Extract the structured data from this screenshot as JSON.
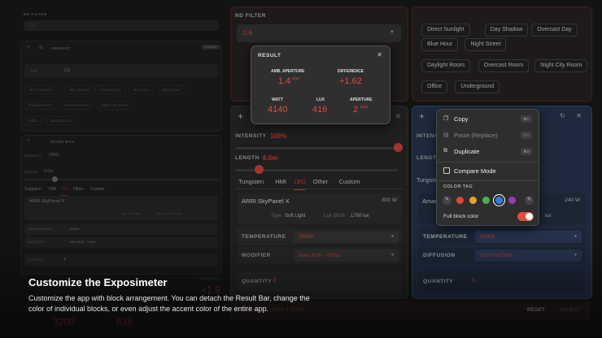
{
  "left_panel": {
    "nd_filter_label": "ND FILTER",
    "nd_filter_value": "0.6",
    "ambient_title": "AMBIENT",
    "ambient_badge": "AMBIENT",
    "lux_label": "Lux",
    "lux_value": "125",
    "chips_row1": [
      "Direct Sunlight",
      "Sky Shadow",
      "Overcast Day",
      "Blue Hour",
      "Night Street"
    ],
    "chips_row2": [
      "Daylight Room",
      "Overcast Room",
      "Night City Room"
    ],
    "chips_row3": [
      "Office",
      "Underground"
    ],
    "moon_box_title": "MOON BOX",
    "intensity_label": "INTENSITY",
    "intensity_value": "100%",
    "length_label": "LENGTH",
    "length_value": "6.0m",
    "tabs": [
      "Tungsten",
      "HMI",
      "LED",
      "Other",
      "Custom"
    ],
    "fixture": "ARRI SkyPanel X",
    "type_text": "Type: Soft Light",
    "lux_text": "Lux @ 2m: 1400 lux",
    "temperature_label": "TEMPERATURE",
    "temperature_value": "5600K",
    "modifier_label": "MODIFIER",
    "modifier_value": "Bare Bulb - HiOut",
    "quantity_label": "QUANTITY",
    "quantity_value": "4",
    "bg_watt": "3200",
    "bg_lux": "638",
    "bg_diff": "+1.9",
    "bg_diff_label": "DIFFERENCE"
  },
  "nd_panel": {
    "label": "ND FILTER",
    "value": "0.6"
  },
  "ambient_chips": {
    "row1": [
      "Direct Sunlight",
      "Day Shadow",
      "Overcast Day"
    ],
    "row2": [
      "Blue Hour",
      "Night Street"
    ],
    "row3": [
      "Daylight Room",
      "Overcast Room",
      "Night City Room"
    ],
    "row4": [
      "Office",
      "Underground"
    ]
  },
  "result": {
    "title": "RESULT",
    "amb_aperture_label": "AMB. APERTURE",
    "amb_aperture_value": "1.4",
    "amb_aperture_fraction": "4/10",
    "difference_label": "DIFFERENCE",
    "difference_value": "+1.62",
    "watt_label": "WATT",
    "watt_value": "4140",
    "lux_label": "LUX",
    "lux_value": "416",
    "aperture_label": "APERTURE",
    "aperture_value": "2",
    "aperture_fraction": "6/10"
  },
  "light_block": {
    "intensity_label": "INTENSITY",
    "intensity_value": "100%",
    "intensity_level": 1.0,
    "length_label": "LENGTH",
    "length_value": "6.0m",
    "tabs": [
      "Tungsten",
      "HMI",
      "LED",
      "Other",
      "Custom"
    ],
    "active_tab": "LED",
    "fixture_name": "ARRI SkyPanel X",
    "fixture_watt": "800 W",
    "type_prefix": "Type",
    "type_value": "Soft Light",
    "lux_prefix": "Lux @1m",
    "lux_value": "1700 lux",
    "temperature_label": "TEMPERATURE",
    "temperature_value": "5600K",
    "modifier_label": "MODIFIER",
    "modifier_value": "Bare Bulb - HiOut",
    "quantity_label": "QUANTITY",
    "quantity_value": "4"
  },
  "right_block": {
    "intensity_label": "INTENS",
    "length_label": "LENGT",
    "tab_partial": "Tungsten",
    "fixture_partial": "Amar",
    "watt": "240 W",
    "lux_partial": "lux",
    "temperature_label": "TEMPERATURE",
    "temperature_value": "5600K",
    "diffusion_label": "DIFFUSION",
    "diffusion_value": "1/2 Grid Cloth",
    "quantity_label": "QUANTITY",
    "quantity_value": "5"
  },
  "context_menu": {
    "copy": "Copy",
    "copy_kbd": "⌘C",
    "paste": "Paste (Replace)",
    "paste_kbd": "⌘V",
    "duplicate": "Duplicate",
    "duplicate_kbd": "⌘D",
    "compare": "Compare Mode",
    "color_tag_label": "COLOR TAG",
    "swatches": [
      "#e0453a",
      "#e8a22f",
      "#4caf50",
      "#2f7fe0",
      "#9c3ab8"
    ],
    "full_block_label": "Full block color",
    "full_block_on": true
  },
  "bottom_bar": {
    "left_text": "ORE 3 ZONE",
    "reset": "RESET",
    "select": "SELECT"
  },
  "caption": {
    "title": "Customize the Exposimeter",
    "body": "Customize the app with block arrangement. You can detach the Result Bar, change the color of individual blocks, or even adjust the accent color of the entire app."
  },
  "colors": {
    "accent": "#e24a40",
    "blue_block": "#2a3a55"
  }
}
